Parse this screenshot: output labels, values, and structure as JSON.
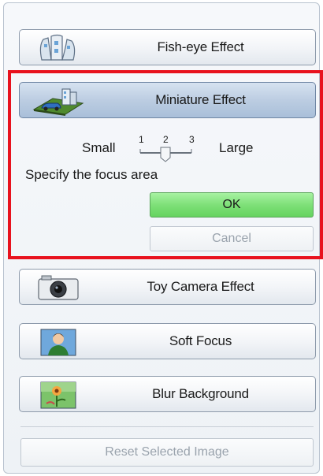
{
  "effects": {
    "fisheye": {
      "label": "Fish-eye Effect",
      "icon": "fisheye-buildings-icon"
    },
    "miniature": {
      "label": "Miniature Effect",
      "icon": "miniature-city-icon",
      "selected": true
    },
    "toycamera": {
      "label": "Toy Camera Effect",
      "icon": "toy-camera-icon"
    },
    "softfocus": {
      "label": "Soft Focus",
      "icon": "portrait-photo-icon"
    },
    "blur": {
      "label": "Blur Background",
      "icon": "flower-photo-icon"
    }
  },
  "miniature_options": {
    "size_small_label": "Small",
    "size_large_label": "Large",
    "ticks": [
      "1",
      "2",
      "3"
    ],
    "selected_size": 2,
    "focus_instruction": "Specify the focus area",
    "ok_label": "OK",
    "cancel_label": "Cancel"
  },
  "reset_label": "Reset Selected Image",
  "colors": {
    "highlight": "#e8121e",
    "ok_green": "#7ee078",
    "selected_blue": "#bccde2"
  }
}
